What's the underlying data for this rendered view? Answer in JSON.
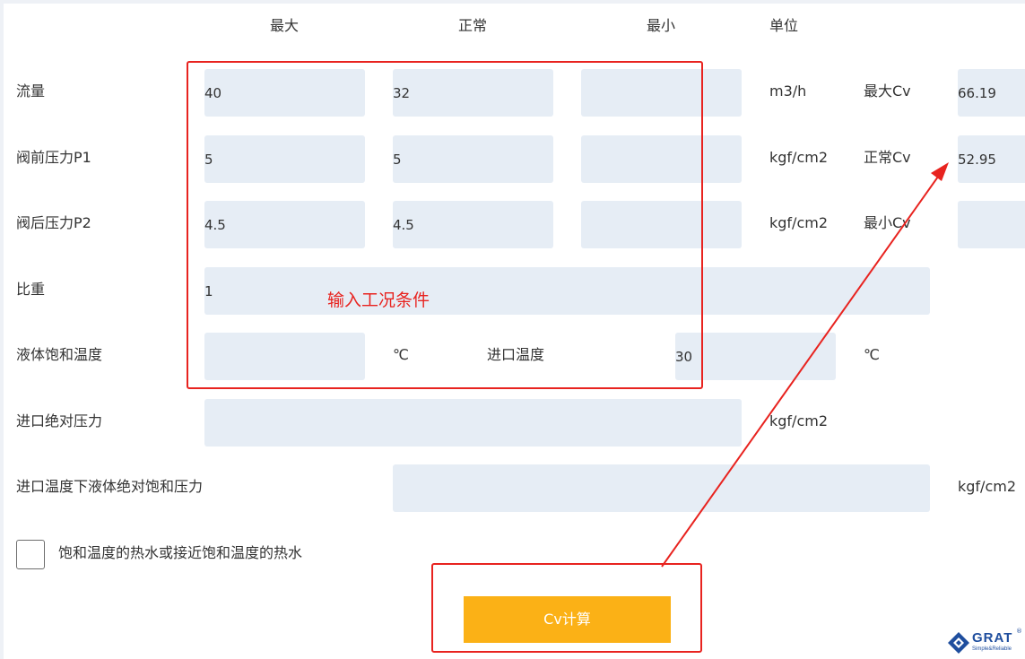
{
  "headers": {
    "max": "最大",
    "normal": "正常",
    "min": "最小",
    "unit": "单位"
  },
  "rows": {
    "flow": {
      "label": "流量",
      "max": "40",
      "normal": "32",
      "min": "",
      "unit": "m3/h"
    },
    "p1": {
      "label": "阀前压力P1",
      "max": "5",
      "normal": "5",
      "min": "",
      "unit": "kgf/cm2"
    },
    "p2": {
      "label": "阀后压力P2",
      "max": "4.5",
      "normal": "4.5",
      "min": "",
      "unit": "kgf/cm2"
    },
    "sg": {
      "label": "比重",
      "value": "1"
    },
    "sat_temp": {
      "label": "液体饱和温度",
      "value": "",
      "unit": "℃",
      "inlet_label": "进口温度",
      "inlet_value": "30",
      "inlet_unit": "℃"
    },
    "inlet_abs_pressure": {
      "label": "进口绝对压力",
      "value": "",
      "unit": "kgf/cm2"
    },
    "sat_pressure": {
      "label": "进口温度下液体绝对饱和压力",
      "value": "",
      "unit": "kgf/cm2"
    }
  },
  "results": {
    "max_label": "最大Cv",
    "max_value": "66.19",
    "normal_label": "正常Cv",
    "normal_value": "52.95",
    "min_label": "最小Cv",
    "min_value": ""
  },
  "checkbox_label": "饱和温度的热水或接近饱和温度的热水",
  "calc_button": "Cv计算",
  "annotation": "输入工况条件",
  "logo": {
    "brand": "GRAT",
    "tagline": "Simple&Reliable",
    "registered": "®"
  },
  "colors": {
    "accent": "#fbb116",
    "field_bg": "#e6edf5",
    "annotation_red": "#e8231f",
    "logo_blue": "#1f4e9e"
  }
}
